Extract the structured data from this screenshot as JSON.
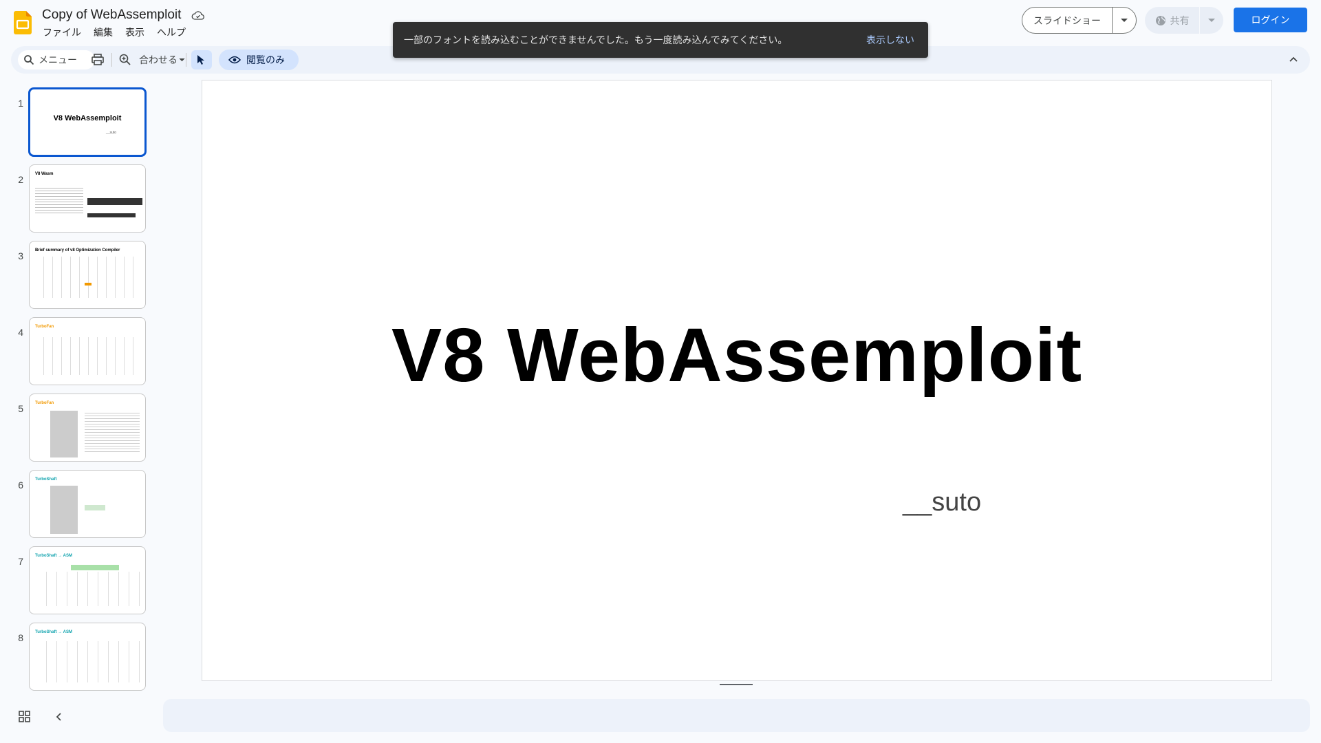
{
  "header": {
    "doc_title": "Copy of WebAssemploit",
    "menu": [
      "ファイル",
      "編集",
      "表示",
      "ヘルプ"
    ],
    "slideshow_label": "スライドショー",
    "share_label": "共有",
    "login_label": "ログイン"
  },
  "toolbar": {
    "search_label": "メニュー",
    "zoom_label": "合わせる",
    "view_only_label": "閲覧のみ"
  },
  "toast": {
    "message": "一部のフォントを読み込むことができませんでした。もう一度読み込んでみてください。",
    "action": "表示しない"
  },
  "filmstrip": {
    "slides": [
      {
        "num": "1",
        "title": "V8 WebAssemploit",
        "sub": "__suto"
      },
      {
        "num": "2",
        "title": "V8 Wasm"
      },
      {
        "num": "3",
        "title": "Brief summary of v8 Optimization Compiler"
      },
      {
        "num": "4",
        "title": "TurboFan"
      },
      {
        "num": "5",
        "title": "TurboFan"
      },
      {
        "num": "6",
        "title": "TurboShaft"
      },
      {
        "num": "7",
        "title": "TurboShaft → ASM"
      },
      {
        "num": "8",
        "title": "TurboShaft → ASM"
      }
    ]
  },
  "slide": {
    "title": "V8 WebAssemploit",
    "subtitle": "__suto"
  },
  "colors": {
    "accent": "#1a73e8",
    "active_thumb": "#0b57d0",
    "toolbar_bg": "#edf2fa"
  }
}
